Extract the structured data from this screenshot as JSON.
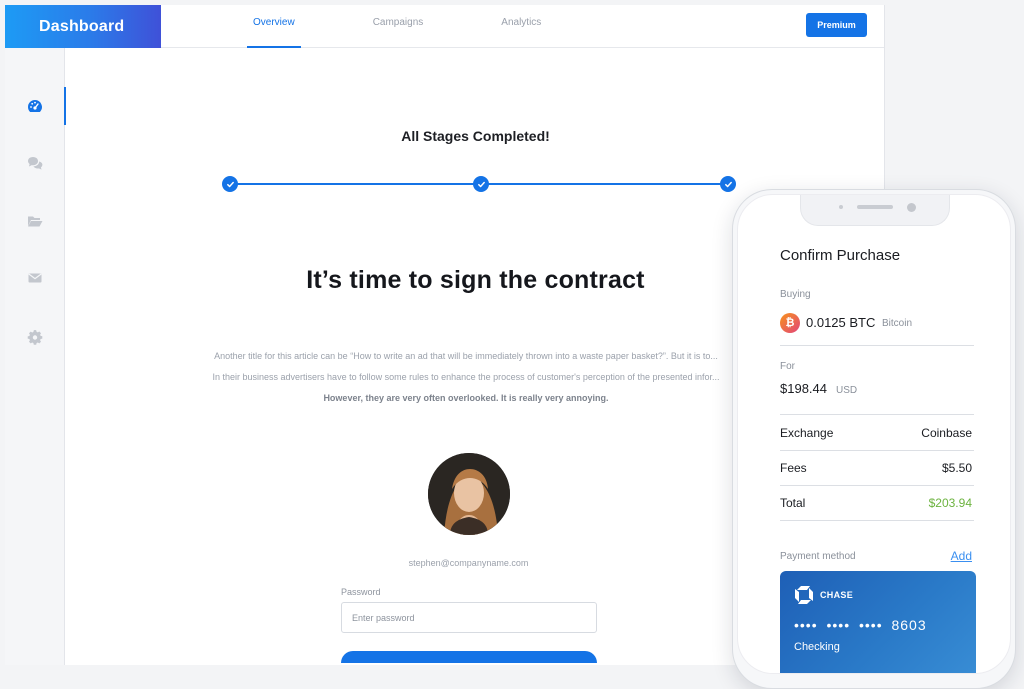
{
  "app": {
    "brand": "Dashboard"
  },
  "tabs": [
    {
      "label": "Overview",
      "active": true
    },
    {
      "label": "Campaigns",
      "active": false
    },
    {
      "label": "Analytics",
      "active": false
    }
  ],
  "header": {
    "premium_label": "Premium"
  },
  "sidebar": {
    "items": [
      {
        "icon": "dashboard-gauge-icon",
        "active": true
      },
      {
        "icon": "chat-bubbles-icon",
        "active": false
      },
      {
        "icon": "folder-open-icon",
        "active": false
      },
      {
        "icon": "envelope-icon",
        "active": false
      },
      {
        "icon": "gear-icon",
        "active": false
      }
    ]
  },
  "main": {
    "stage_title": "All Stages Completed!",
    "steps_completed": 3,
    "steps_total": 3,
    "headline": "It’s time to sign the contract",
    "paragraph": {
      "line1": "Another title for this article can be “How to write an ad that will be immediately thrown into a waste paper basket?”. But it is to...",
      "line2": "In their business advertisers have to follow some rules to enhance the process of customer's perception of the presented infor...",
      "line3": "However, they are very often overlooked. It is really very annoying."
    },
    "email": "stephen@companyname.com",
    "password_label": "Password",
    "password_placeholder": "Enter password"
  },
  "phone": {
    "title": "Confirm Purchase",
    "buying_label": "Buying",
    "btc_symbol": "₿",
    "btc_amount": "0.0125 BTC",
    "btc_name": "Bitcoin",
    "for_label": "For",
    "usd_amount": "$198.44",
    "usd_currency": "USD",
    "rows": [
      {
        "label": "Exchange",
        "value": "Coinbase"
      },
      {
        "label": "Fees",
        "value": "$5.50"
      },
      {
        "label": "Total",
        "value": "$203.94"
      }
    ],
    "payment_label": "Payment method",
    "add_label": "Add",
    "card": {
      "bank": "CHASE",
      "number": "•••• •••• •••• 8603",
      "type": "Checking"
    }
  },
  "colors": {
    "accent": "#1473e6",
    "brand_gradient_start": "#1d9bf5",
    "brand_gradient_end": "#3f51d8",
    "total_green": "#6cb33f"
  }
}
